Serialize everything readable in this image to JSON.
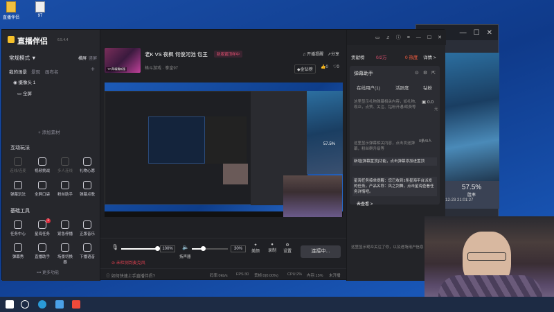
{
  "desktop": {
    "icons": [
      {
        "label": "直播伴侣",
        "icon": "shortcut-icon"
      },
      {
        "label": "97",
        "icon": "file-icon"
      }
    ]
  },
  "app": {
    "name": "直播伴侣",
    "version": "6.5.4.4",
    "scene_mode": "常规模式",
    "scene_mode_arrow": "▼",
    "edit_label": "横屏",
    "portrait_label": "竖屏",
    "my_scenes_label": "我的场景",
    "scene_tab2": "景观",
    "scene_tab3": "画布名",
    "add_scene": "+",
    "sources": [
      {
        "label": "摄像头 1"
      },
      {
        "label": "全屏"
      }
    ],
    "add_source_label": "+ 添加素材",
    "interactive_section": "互动玩法",
    "interactive_items": [
      {
        "label": "连线/连麦",
        "enabled": false
      },
      {
        "label": "视频挑战",
        "enabled": true
      },
      {
        "label": "多人连线",
        "enabled": false
      },
      {
        "label": "礼物心愿",
        "enabled": true
      },
      {
        "label": "弹幕玩法",
        "enabled": true
      },
      {
        "label": "全屏口袋",
        "enabled": true
      },
      {
        "label": "粉丝助手",
        "enabled": true
      },
      {
        "label": "弹幕点歌",
        "enabled": true
      }
    ],
    "tools_section": "基础工具",
    "tools_items": [
      {
        "label": "任务中心",
        "badge": ""
      },
      {
        "label": "星海任务",
        "badge": "1"
      },
      {
        "label": "紧急停播",
        "badge": ""
      },
      {
        "label": "正版音乐",
        "badge": ""
      },
      {
        "label": "弹幕秀",
        "badge": ""
      },
      {
        "label": "直播助手",
        "badge": ""
      },
      {
        "label": "场景切换器",
        "badge": ""
      },
      {
        "label": "下播语音",
        "badge": ""
      }
    ],
    "more_label": "••• 更多功能"
  },
  "room": {
    "title": "老K VS 夜枫 何俊河池 包王",
    "tag": "新版置顶样中",
    "category": "格斗游戏 · 拳皇97",
    "notice_label": "开播提醒",
    "share_label": "分享",
    "gold_label": "金钻榜",
    "like_count": "0",
    "heart_count": "0",
    "thumb_text": "TPI拜精猜新版"
  },
  "controls": {
    "mic_volume": "100%",
    "mic_level": 1.0,
    "speaker_volume": "30%",
    "speaker_level": 0.3,
    "speaker_label": "扬声器",
    "beauty_label": "美颜",
    "record_label": "录制",
    "settings_label": "设置",
    "connect_label": "连接中...",
    "warning_text": "未检测到麦克风"
  },
  "status": {
    "help": "如何快速上手直播伴侣?",
    "bitrate": "码率:0kb/s",
    "fps": "FPS:30",
    "dropped": "丢帧:0(0.00%)",
    "cpu": "CPU:2%",
    "mem": "内存:15%",
    "network": "未开播"
  },
  "window_controls": [
    "chat-icon",
    "headset-icon",
    "info-icon",
    "menu-icon",
    "minimize-icon",
    "maximize-icon",
    "close-icon"
  ],
  "right": {
    "contribution": "贡献榜",
    "fans_count": "0/2万",
    "hot_label": "0 热度",
    "detail_label": "详情 >",
    "danmaku_title": "弹幕助手",
    "tabs": [
      "在线用户(1)",
      "活跃度",
      "钻粉"
    ],
    "online_info": "这里显示礼物弹幕相关内容，如礼物、观众，点赞、关注、钻粉开通/续费等",
    "amount": "0.0",
    "amount_unit": "元",
    "count_label": "0条/0人",
    "no_danmaku": "这里显示弹幕相关内容，点击发送弹幕，粉丝群升级等",
    "feature_notice": "新增[弹幕置顶]功能，点击弹幕添加进置顶",
    "task_notice": "星海任务接单提醒：您已收到1条星海平台派发的任务，产品名称：风之剑舞，点击星海查看任务详情吧。",
    "go_view": "去查看 >",
    "bottom_info": "这里显示观众关注了你，以及进场用户信息"
  },
  "bg_window": {
    "percent": "57.5%",
    "percent_label": "胜率",
    "timestamp": "-12-23 21:01:27"
  },
  "taskbar_icons": [
    "windows-icon",
    "search-icon",
    "edge-icon",
    "browser-icon",
    "douyin-icon"
  ]
}
